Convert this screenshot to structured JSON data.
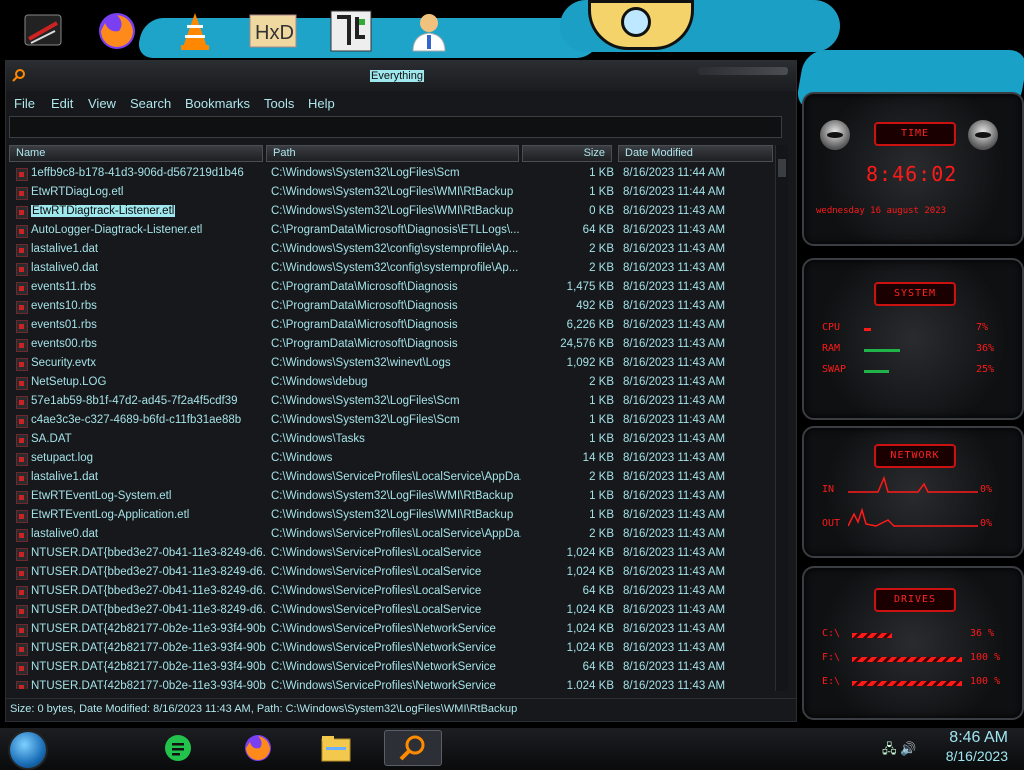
{
  "window": {
    "title": "Everything",
    "menus": [
      "File",
      "Edit",
      "View",
      "Search",
      "Bookmarks",
      "Tools",
      "Help"
    ],
    "search_value": "",
    "columns": {
      "name": "Name",
      "path": "Path",
      "size": "Size",
      "date": "Date Modified"
    },
    "rows": [
      {
        "name": "1effb9c8-b178-41d3-906d-d567219d1b46",
        "path": "C:\\Windows\\System32\\LogFiles\\Scm",
        "size": "1 KB",
        "date": "8/16/2023 11:44 AM"
      },
      {
        "name": "EtwRTDiagLog.etl",
        "path": "C:\\Windows\\System32\\LogFiles\\WMI\\RtBackup",
        "size": "1 KB",
        "date": "8/16/2023 11:44 AM"
      },
      {
        "name": "EtwRTDiagtrack-Listener.etl",
        "path": "C:\\Windows\\System32\\LogFiles\\WMI\\RtBackup",
        "size": "0 KB",
        "date": "8/16/2023 11:43 AM"
      },
      {
        "name": "AutoLogger-Diagtrack-Listener.etl",
        "path": "C:\\ProgramData\\Microsoft\\Diagnosis\\ETLLogs\\...",
        "size": "64 KB",
        "date": "8/16/2023 11:43 AM"
      },
      {
        "name": "lastalive1.dat",
        "path": "C:\\Windows\\System32\\config\\systemprofile\\Ap...",
        "size": "2 KB",
        "date": "8/16/2023 11:43 AM"
      },
      {
        "name": "lastalive0.dat",
        "path": "C:\\Windows\\System32\\config\\systemprofile\\Ap...",
        "size": "2 KB",
        "date": "8/16/2023 11:43 AM"
      },
      {
        "name": "events11.rbs",
        "path": "C:\\ProgramData\\Microsoft\\Diagnosis",
        "size": "1,475 KB",
        "date": "8/16/2023 11:43 AM"
      },
      {
        "name": "events10.rbs",
        "path": "C:\\ProgramData\\Microsoft\\Diagnosis",
        "size": "492 KB",
        "date": "8/16/2023 11:43 AM"
      },
      {
        "name": "events01.rbs",
        "path": "C:\\ProgramData\\Microsoft\\Diagnosis",
        "size": "6,226 KB",
        "date": "8/16/2023 11:43 AM"
      },
      {
        "name": "events00.rbs",
        "path": "C:\\ProgramData\\Microsoft\\Diagnosis",
        "size": "24,576 KB",
        "date": "8/16/2023 11:43 AM"
      },
      {
        "name": "Security.evtx",
        "path": "C:\\Windows\\System32\\winevt\\Logs",
        "size": "1,092 KB",
        "date": "8/16/2023 11:43 AM"
      },
      {
        "name": "NetSetup.LOG",
        "path": "C:\\Windows\\debug",
        "size": "2 KB",
        "date": "8/16/2023 11:43 AM"
      },
      {
        "name": "57e1ab59-8b1f-47d2-ad45-7f2a4f5cdf39",
        "path": "C:\\Windows\\System32\\LogFiles\\Scm",
        "size": "1 KB",
        "date": "8/16/2023 11:43 AM"
      },
      {
        "name": "c4ae3c3e-c327-4689-b6fd-c11fb31ae88b",
        "path": "C:\\Windows\\System32\\LogFiles\\Scm",
        "size": "1 KB",
        "date": "8/16/2023 11:43 AM"
      },
      {
        "name": "SA.DAT",
        "path": "C:\\Windows\\Tasks",
        "size": "1 KB",
        "date": "8/16/2023 11:43 AM"
      },
      {
        "name": "setupact.log",
        "path": "C:\\Windows",
        "size": "14 KB",
        "date": "8/16/2023 11:43 AM"
      },
      {
        "name": "lastalive1.dat",
        "path": "C:\\Windows\\ServiceProfiles\\LocalService\\AppDa...",
        "size": "2 KB",
        "date": "8/16/2023 11:43 AM"
      },
      {
        "name": "EtwRTEventLog-System.etl",
        "path": "C:\\Windows\\System32\\LogFiles\\WMI\\RtBackup",
        "size": "1 KB",
        "date": "8/16/2023 11:43 AM"
      },
      {
        "name": "EtwRTEventLog-Application.etl",
        "path": "C:\\Windows\\System32\\LogFiles\\WMI\\RtBackup",
        "size": "1 KB",
        "date": "8/16/2023 11:43 AM"
      },
      {
        "name": "lastalive0.dat",
        "path": "C:\\Windows\\ServiceProfiles\\LocalService\\AppDa...",
        "size": "2 KB",
        "date": "8/16/2023 11:43 AM"
      },
      {
        "name": "NTUSER.DAT{bbed3e27-0b41-11e3-8249-d6...",
        "path": "C:\\Windows\\ServiceProfiles\\LocalService",
        "size": "1,024 KB",
        "date": "8/16/2023 11:43 AM"
      },
      {
        "name": "NTUSER.DAT{bbed3e27-0b41-11e3-8249-d6...",
        "path": "C:\\Windows\\ServiceProfiles\\LocalService",
        "size": "1,024 KB",
        "date": "8/16/2023 11:43 AM"
      },
      {
        "name": "NTUSER.DAT{bbed3e27-0b41-11e3-8249-d6...",
        "path": "C:\\Windows\\ServiceProfiles\\LocalService",
        "size": "64 KB",
        "date": "8/16/2023 11:43 AM"
      },
      {
        "name": "NTUSER.DAT{bbed3e27-0b41-11e3-8249-d6...",
        "path": "C:\\Windows\\ServiceProfiles\\LocalService",
        "size": "1,024 KB",
        "date": "8/16/2023 11:43 AM"
      },
      {
        "name": "NTUSER.DAT{42b82177-0b2e-11e3-93f4-90b...",
        "path": "C:\\Windows\\ServiceProfiles\\NetworkService",
        "size": "1,024 KB",
        "date": "8/16/2023 11:43 AM"
      },
      {
        "name": "NTUSER.DAT{42b82177-0b2e-11e3-93f4-90b...",
        "path": "C:\\Windows\\ServiceProfiles\\NetworkService",
        "size": "1,024 KB",
        "date": "8/16/2023 11:43 AM"
      },
      {
        "name": "NTUSER.DAT{42b82177-0b2e-11e3-93f4-90b...",
        "path": "C:\\Windows\\ServiceProfiles\\NetworkService",
        "size": "64 KB",
        "date": "8/16/2023 11:43 AM"
      },
      {
        "name": "NTUSER.DAT{42b82177-0b2e-11e3-93f4-90b...",
        "path": "C:\\Windows\\ServiceProfiles\\NetworkService",
        "size": "1,024 KB",
        "date": "8/16/2023 11:43 AM"
      }
    ],
    "selected_row": 2,
    "status": "Size: 0 bytes, Date Modified: 8/16/2023 11:43 AM, Path: C:\\Windows\\System32\\LogFiles\\WMI\\RtBackup"
  },
  "widgets": {
    "time": {
      "title": "TIME",
      "clock": "8:46:02",
      "date": "wednesday 16 august 2023"
    },
    "system": {
      "title": "SYSTEM",
      "rows": [
        {
          "label": "CPU",
          "value": "7%",
          "level": 0.07
        },
        {
          "label": "RAM",
          "value": "36%",
          "level": 0.36
        },
        {
          "label": "SWAP",
          "value": "25%",
          "level": 0.25
        }
      ]
    },
    "network": {
      "title": "NETWORK",
      "rows": [
        {
          "label": "IN",
          "value": "0%"
        },
        {
          "label": "OUT",
          "value": "0%"
        }
      ]
    },
    "drives": {
      "title": "DRIVES",
      "rows": [
        {
          "label": "C:\\",
          "value": "36 %",
          "level": 0.36
        },
        {
          "label": "F:\\",
          "value": "100 %",
          "level": 1.0
        },
        {
          "label": "E:\\",
          "value": "100 %",
          "level": 1.0
        }
      ]
    }
  },
  "taskbar": {
    "time": "8:46 AM",
    "date": "8/16/2023"
  },
  "colors": {
    "accent": "#9ee8ee",
    "red": "#ff1a1a"
  }
}
